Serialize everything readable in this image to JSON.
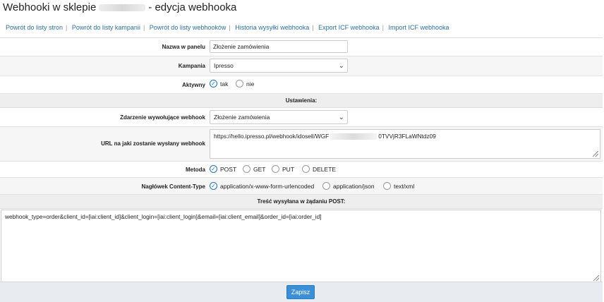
{
  "header": {
    "title_prefix": "Webhooki w sklepie",
    "title_suffix": "- edycja webhooka"
  },
  "nav": {
    "links": [
      "Powrót do listy stron",
      "Powrót do listy kampanii",
      "Powrót do listy webhooków",
      "Historia wysyłki webhooka",
      "Export ICF webhooka",
      "Import ICF webhooka"
    ]
  },
  "form": {
    "name_label": "Nazwa w panelu",
    "name_value": "Złożenie zamówienia",
    "campaign_label": "Kampania",
    "campaign_value": "Ipresso",
    "active_label": "Aktywny",
    "active_options": [
      "tak",
      "nie"
    ],
    "active_selected": "tak",
    "settings_header": "Ustawienia:",
    "event_label": "Zdarzenie wywołujące webhook",
    "event_value": "Złożenie zamówienia",
    "url_label": "URL na jaki zostanie wysłany webhook",
    "url_value_start": "https://hello.ipresso.pl/webhook/idosell/WGF",
    "url_value_end": "0TVVjR3FLaWNtdz09",
    "method_label": "Metoda",
    "method_options": [
      "POST",
      "GET",
      "PUT",
      "DELETE"
    ],
    "method_selected": "POST",
    "content_type_label": "Nagłówek Content-Type",
    "content_type_options": [
      "application/x-www-form-urlencoded",
      "application/json",
      "text/xml"
    ],
    "content_type_selected": "application/x-www-form-urlencoded",
    "body_header": "Treść wysyłana w żądaniu POST:",
    "body_value": "webhook_type=order&client_id=[iai:client_id]&client_login=[iai:client_login]&email=[iai:client_email]&order_id=[iai:order_id]"
  },
  "footer": {
    "save_label": "Zapisz"
  },
  "colors": {
    "link": "#2a6fa8",
    "accent": "#3a8fd6",
    "section_bg": "#eeeeee"
  }
}
